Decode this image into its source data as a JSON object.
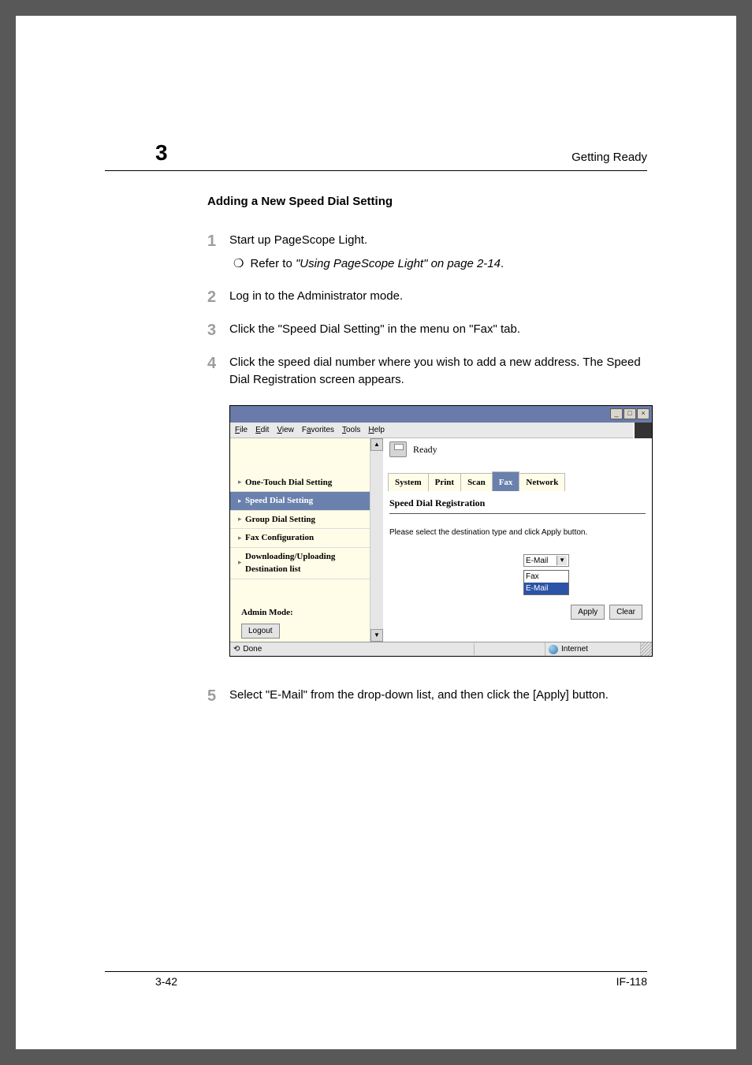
{
  "chapter_number": "3",
  "header_title": "Getting Ready",
  "section_heading": "Adding a New Speed Dial Setting",
  "steps": {
    "1": {
      "num": "1",
      "text": "Start up PageScope Light.",
      "sub_prefix": "Refer to ",
      "sub_italic": "\"Using PageScope Light\" on page 2-14",
      "sub_suffix": "."
    },
    "2": {
      "num": "2",
      "text": "Log in to the Administrator mode."
    },
    "3": {
      "num": "3",
      "text": "Click the  \"Speed Dial Setting\" in the menu on \"Fax\" tab."
    },
    "4": {
      "num": "4",
      "text": "Click the speed dial number where you wish to add a new address. The Speed Dial Registration screen appears."
    },
    "5": {
      "num": "5",
      "text": "Select \"E-Mail\" from the drop-down list, and then click the [Apply] button."
    }
  },
  "screenshot": {
    "menubar": {
      "file": "File",
      "edit": "Edit",
      "view": "View",
      "favorites": "Favorites",
      "tools": "Tools",
      "help": "Help"
    },
    "sidebar": {
      "items": {
        "0": "One-Touch Dial Setting",
        "1": "Speed Dial Setting",
        "2": "Group Dial Setting",
        "3": "Fax Configuration",
        "4a": "Downloading/Uploading",
        "4b": "Destination list"
      },
      "admin_label": "Admin Mode:",
      "logout": "Logout"
    },
    "status_text": "Ready",
    "tabs": {
      "system": "System",
      "print": "Print",
      "scan": "Scan",
      "fax": "Fax",
      "network": "Network"
    },
    "panel": {
      "title": "Speed Dial Registration",
      "instruction": "Please select the destination type and click Apply button.",
      "dropdown_selected": "E-Mail",
      "options": {
        "fax": "Fax",
        "email": "E-Mail"
      },
      "apply": "Apply",
      "clear": "Clear"
    },
    "statusbar": {
      "done": "Done",
      "zone": "Internet"
    }
  },
  "footer": {
    "left": "3-42",
    "right": "IF-118"
  }
}
